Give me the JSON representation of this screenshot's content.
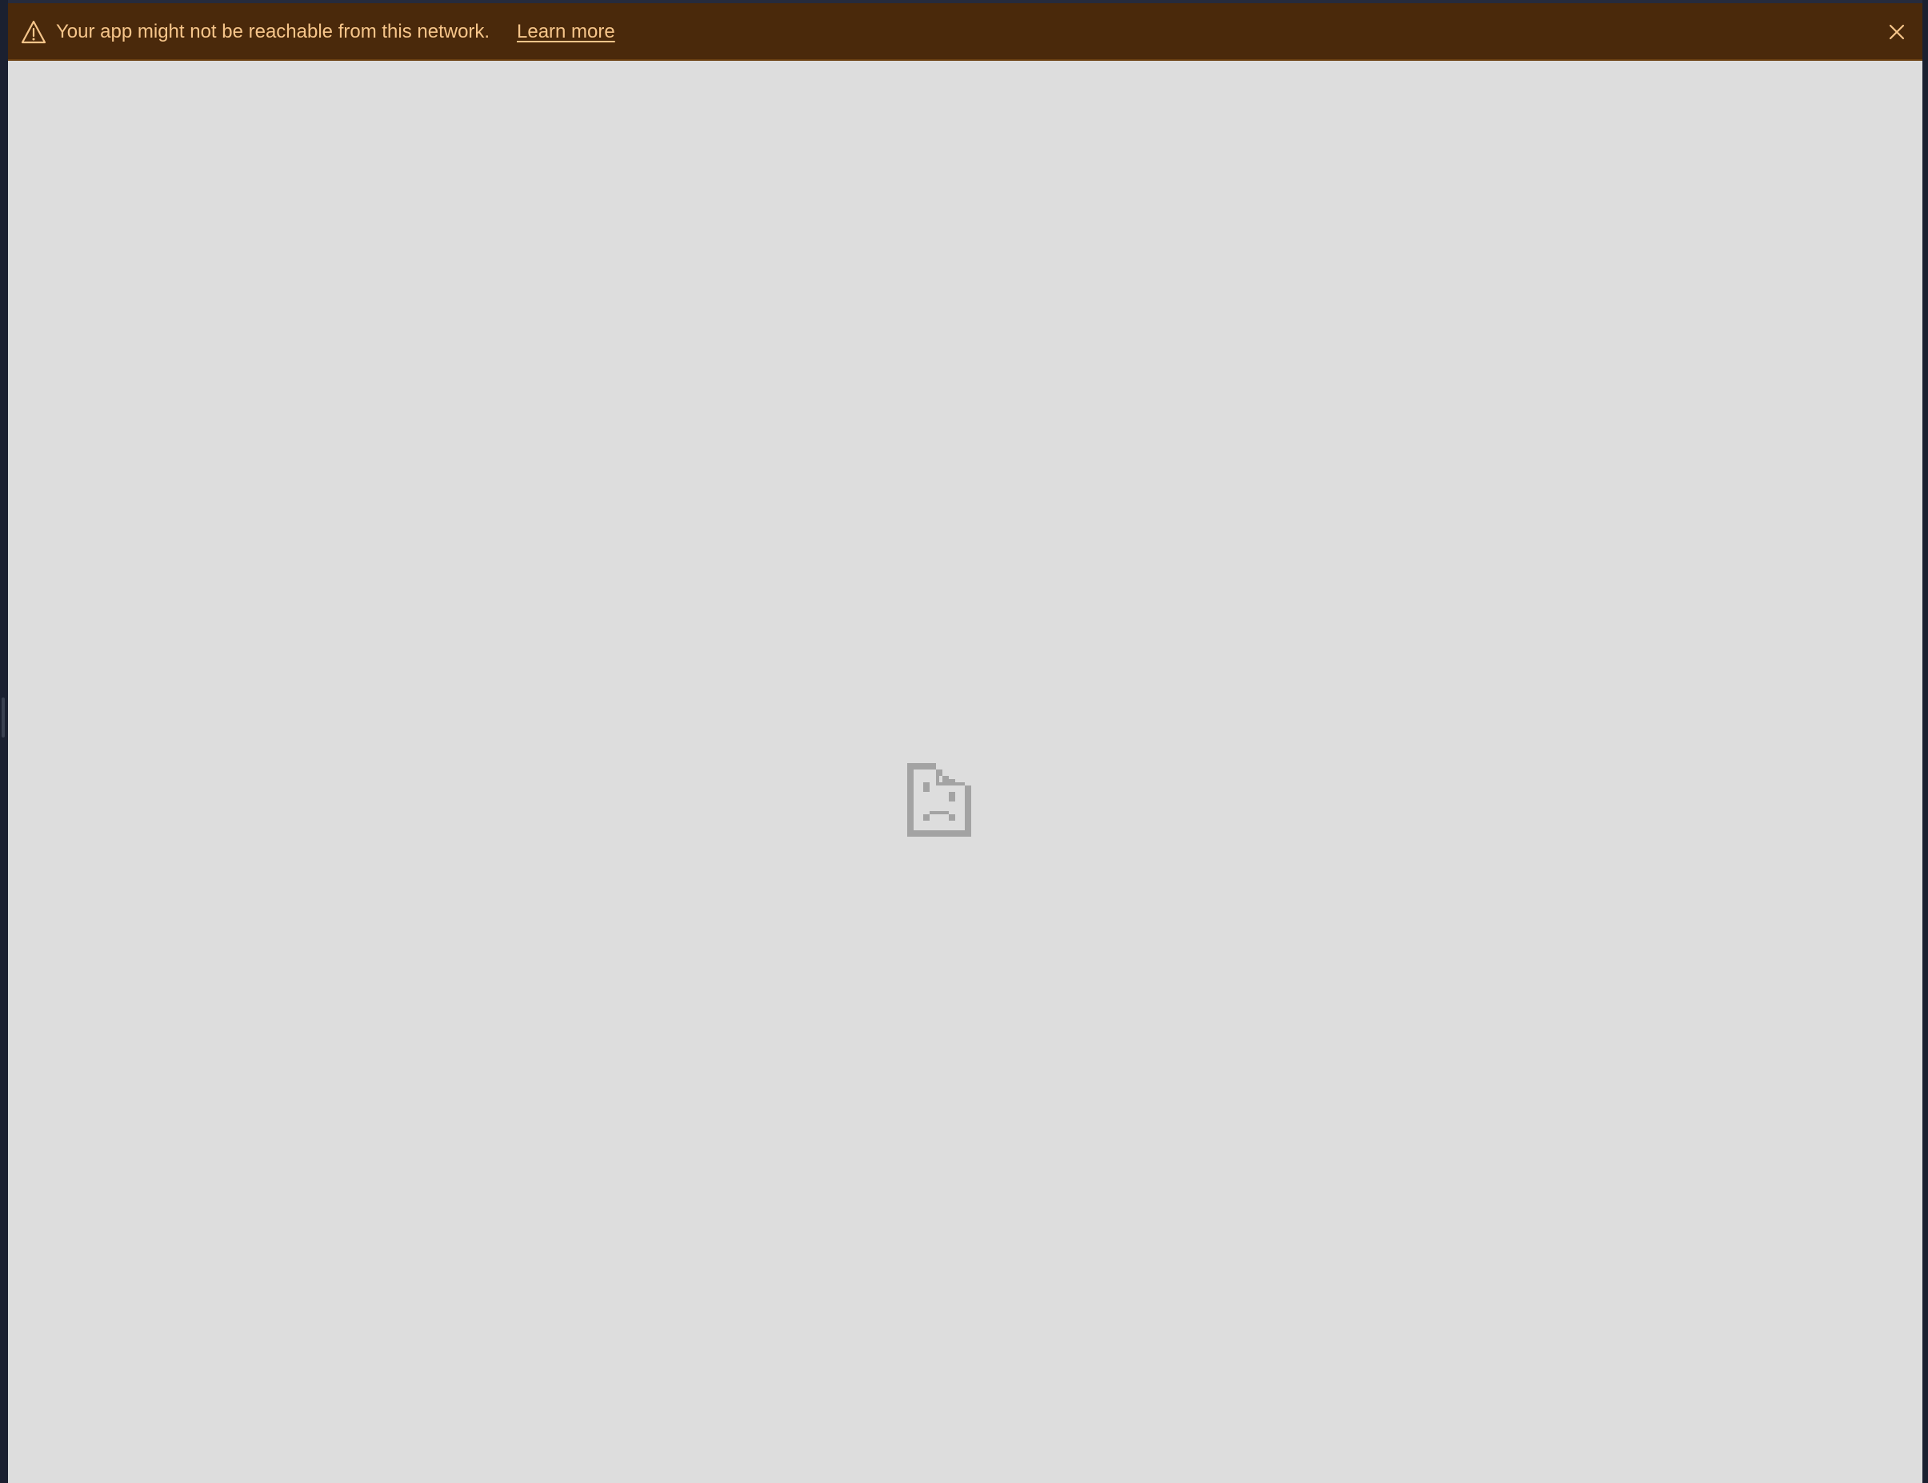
{
  "banner": {
    "message": "Your app might not be reachable from this network.",
    "link_label": "Learn more",
    "warning_icon": "warning-triangle-icon",
    "close_icon": "close-icon",
    "background_color": "#4a290b",
    "text_color": "#f6c58a"
  },
  "content": {
    "background_color": "#dddddd",
    "error_icon": "sad-page-icon"
  }
}
